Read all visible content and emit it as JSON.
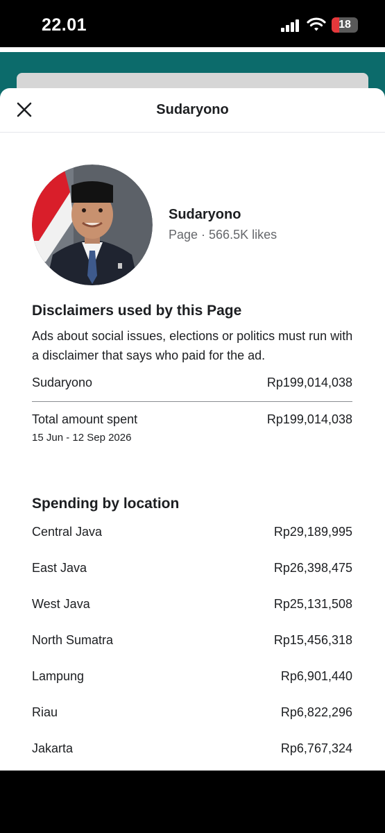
{
  "status_bar": {
    "time": "22.01",
    "battery": "18"
  },
  "sheet": {
    "title": "Sudaryono"
  },
  "profile": {
    "name": "Sudaryono",
    "meta": "Page · 566.5K likes"
  },
  "disclaimers": {
    "title": "Disclaimers used by this Page",
    "description": "Ads about social issues, elections or politics must run with a disclaimer that says who paid for the ad.",
    "entries": [
      {
        "label": "Sudaryono",
        "value": "Rp199,014,038"
      }
    ]
  },
  "total": {
    "label": "Total amount spent",
    "value": "Rp199,014,038",
    "date_range": "15 Jun - 12 Sep 2026"
  },
  "spending": {
    "title": "Spending by location",
    "rows": [
      {
        "location": "Central Java",
        "amount": "Rp29,189,995"
      },
      {
        "location": "East Java",
        "amount": "Rp26,398,475"
      },
      {
        "location": "West Java",
        "amount": "Rp25,131,508"
      },
      {
        "location": "North Sumatra",
        "amount": "Rp15,456,318"
      },
      {
        "location": "Lampung",
        "amount": "Rp6,901,440"
      },
      {
        "location": "Riau",
        "amount": "Rp6,822,296"
      },
      {
        "location": "Jakarta",
        "amount": "Rp6,767,324"
      }
    ]
  },
  "icons": {
    "close": "close-icon",
    "signal": "cellular-signal-icon",
    "wifi": "wifi-icon",
    "battery": "battery-icon",
    "avatar": "profile-photo"
  },
  "colors": {
    "teal_background": "#0c6b6b",
    "battery_low": "#e5383b",
    "secondary_text": "#65676b"
  }
}
